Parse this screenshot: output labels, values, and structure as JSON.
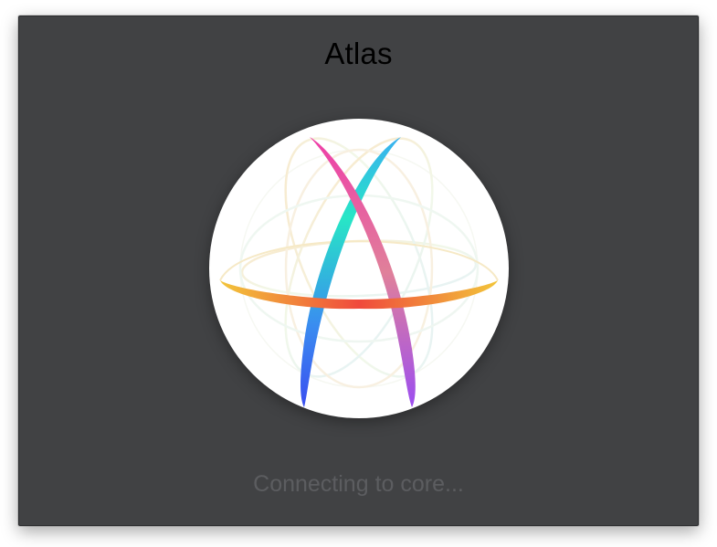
{
  "window": {
    "title": "Atlas",
    "status": "Connecting to core..."
  },
  "logo": {
    "icon": "atlas-sphere-logo-icon",
    "background": "#ffffff",
    "colors": {
      "equator_left": "#f2c53a",
      "equator_center": "#f04a3c",
      "equator_right": "#f2c53a",
      "stroke_left_top": "#27e6c6",
      "stroke_left_bottom": "#3a4ff0",
      "stroke_right_top": "#ee3ea8",
      "stroke_right_bottom": "#9c4ef0"
    }
  }
}
